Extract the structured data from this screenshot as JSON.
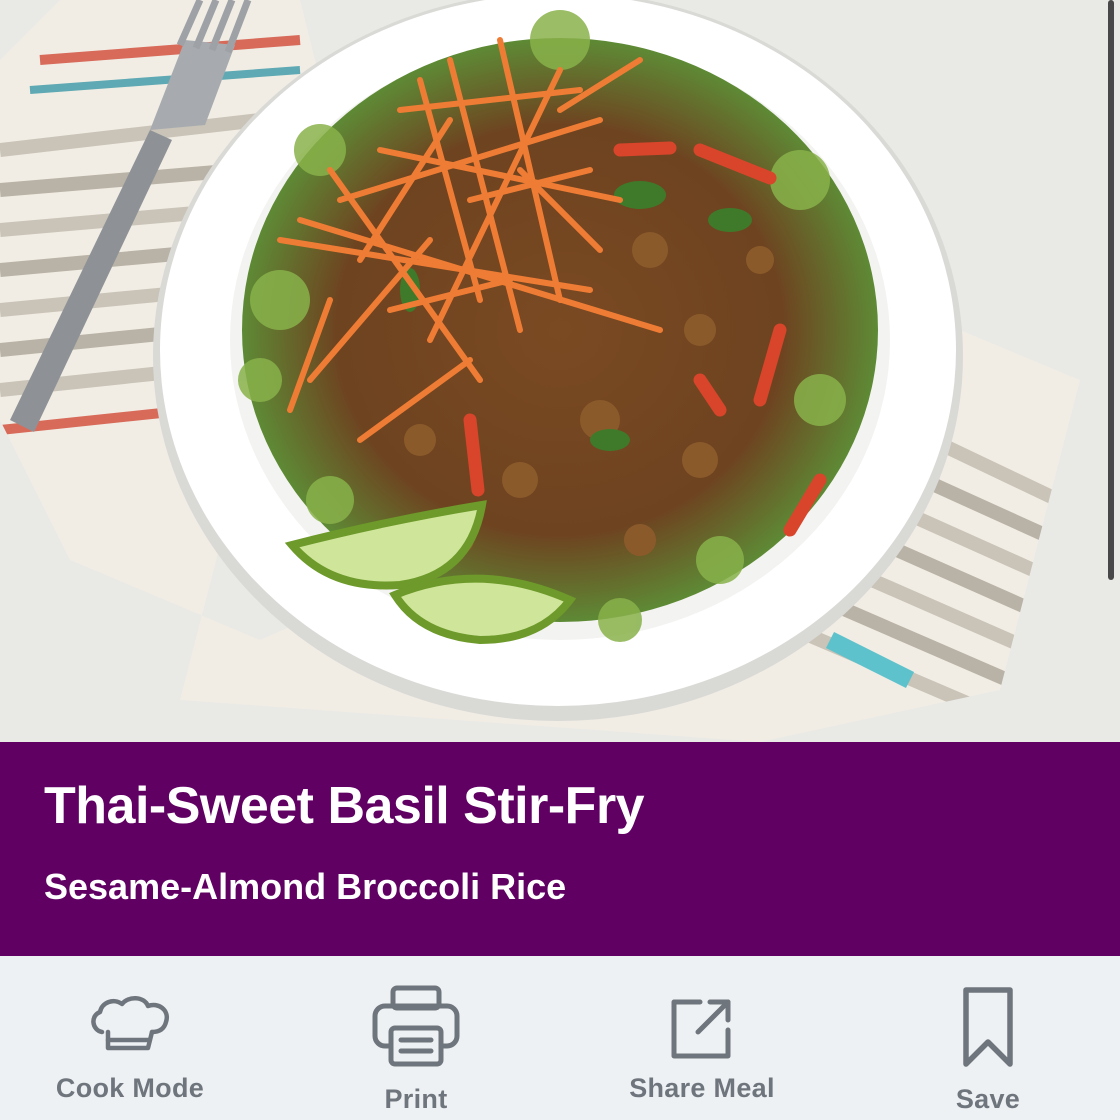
{
  "hero": {
    "image_label": "bowl-of-stir-fry-photo"
  },
  "recipe": {
    "title": "Thai-Sweet Basil Stir-Fry",
    "subtitle": "Sesame-Almond Broccoli Rice"
  },
  "theme": {
    "band_color": "#5f0062",
    "action_color": "#6f757c",
    "bar_background": "#eef1f4"
  },
  "actions": [
    {
      "label": "Cook Mode",
      "icon": "chef-hat-icon"
    },
    {
      "label": "Print",
      "icon": "printer-icon"
    },
    {
      "label": "Share Meal",
      "icon": "share-icon"
    },
    {
      "label": "Save",
      "icon": "bookmark-icon"
    }
  ]
}
